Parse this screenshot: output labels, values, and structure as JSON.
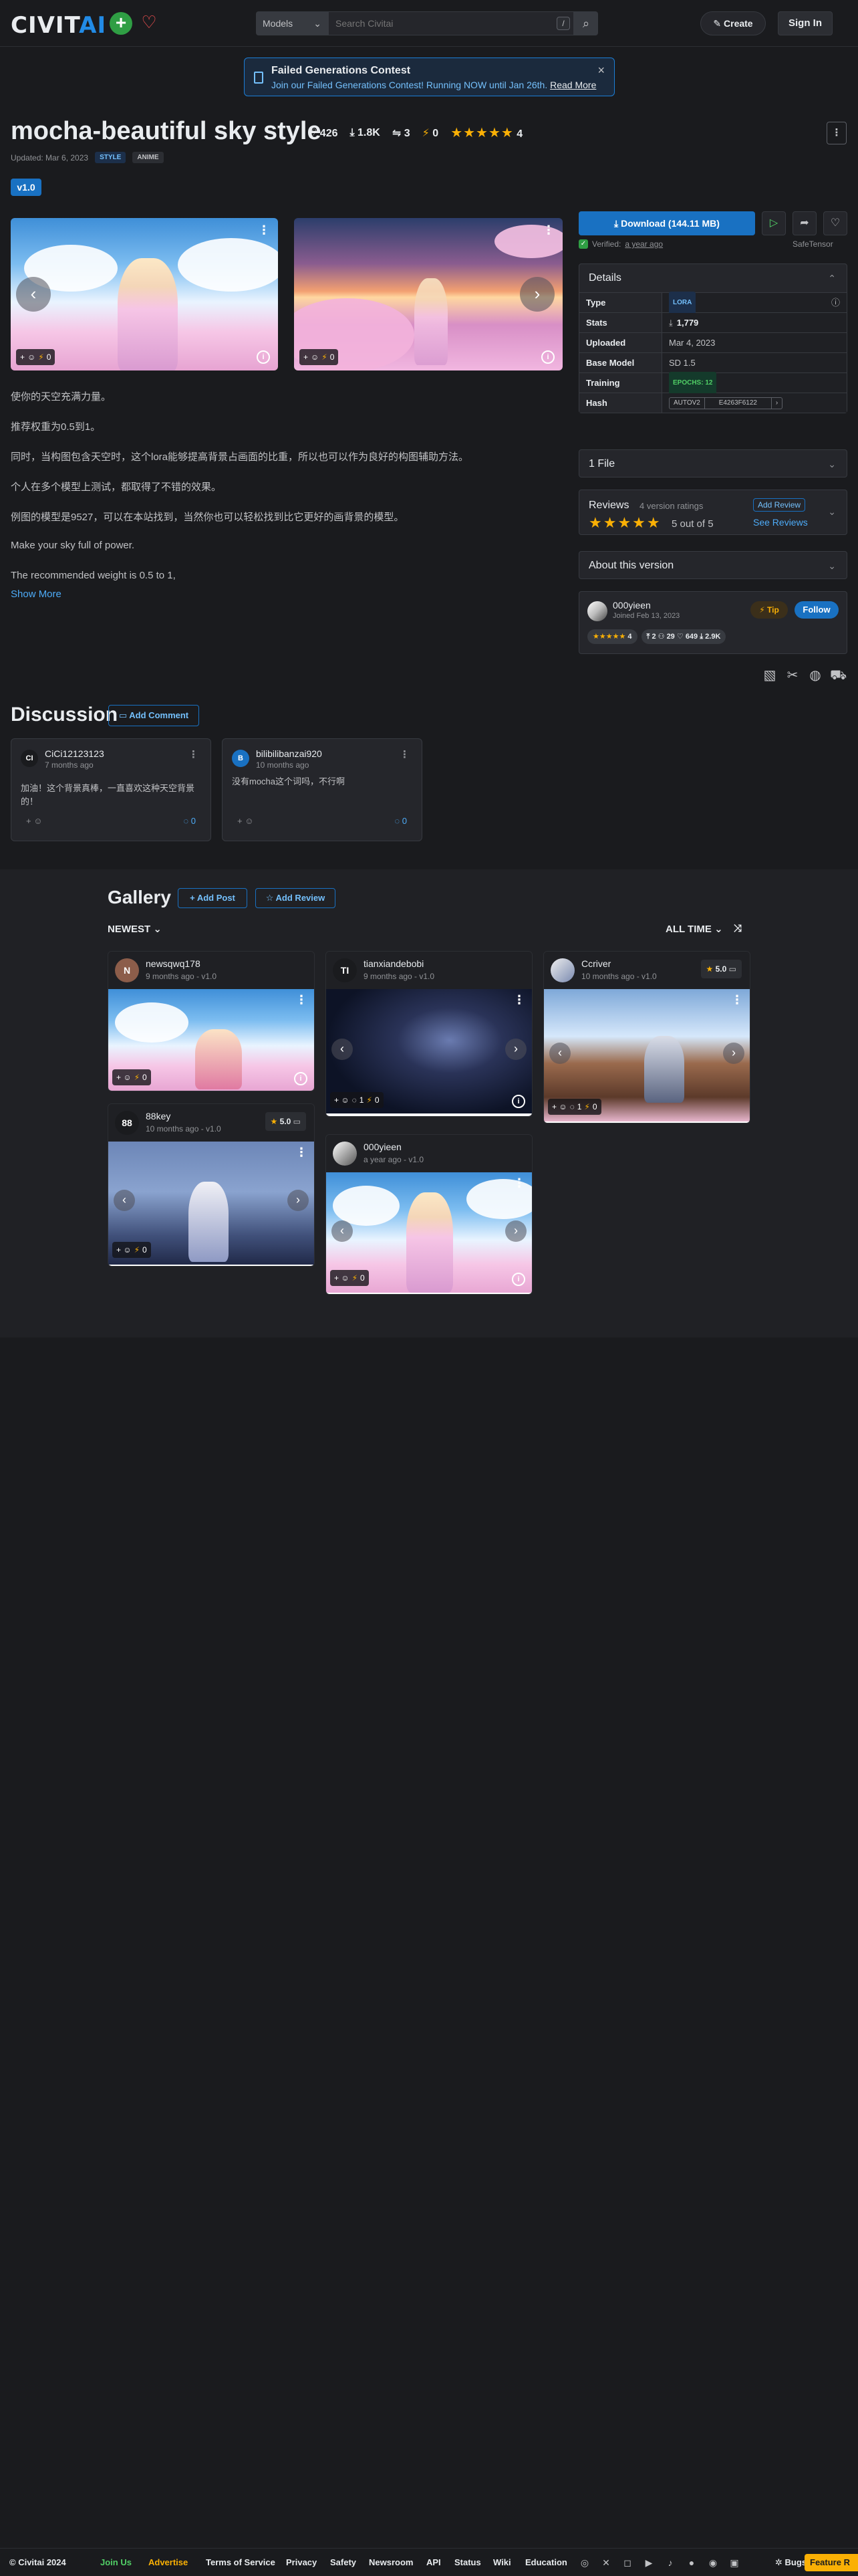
{
  "header": {
    "logo_text": "CIVIT",
    "logo_ai": "AI",
    "search_scope": "Models",
    "search_placeholder": "Search Civitai",
    "search_shortcut": "/",
    "create_label": "Create",
    "signin_label": "Sign In"
  },
  "banner": {
    "title": "Failed Generations Contest",
    "text": "Join our Failed Generations Contest! Running NOW until Jan 26th.",
    "link": "Read More"
  },
  "model": {
    "title": "mocha-beautiful sky style",
    "likes": "426",
    "downloads": "1.8K",
    "comments": "3",
    "buzz": "0",
    "rating_stars": "★★★★★",
    "rating_count": "4",
    "updated": "Updated: Mar 6, 2023",
    "tags": [
      "STYLE",
      "ANIME"
    ],
    "version": "v1.0"
  },
  "images": {
    "img1_reaction_count": "0",
    "img2_reaction_count": "0"
  },
  "description": [
    "使你的天空充满力量。",
    "推荐权重为0.5到1。",
    "同时，当构图包含天空时，这个lora能够提高背景占画面的比重，所以也可以作为良好的构图辅助方法。",
    "个人在多个模型上测试，都取得了不错的效果。",
    "例图的模型是9527，可以在本站找到，当然你也可以轻松找到比它更好的画背景的模型。",
    "Make your sky full of power.",
    "The recommended weight is 0.5 to 1,"
  ],
  "show_more": "Show More",
  "sidebar": {
    "download_label": "Download (144.11 MB)",
    "verified_label": "Verified:",
    "verified_when": "a year ago",
    "file_format": "SafeTensor",
    "details_title": "Details",
    "details": [
      {
        "key": "Type",
        "value": "LORA"
      },
      {
        "key": "Stats",
        "value": "1,779"
      },
      {
        "key": "Uploaded",
        "value": "Mar 4, 2023"
      },
      {
        "key": "Base Model",
        "value": "SD 1.5"
      },
      {
        "key": "Training",
        "value": "EPOCHS: 12"
      },
      {
        "key": "Hash",
        "value": "AUTOV2"
      }
    ],
    "hash_value": "E4263F6122",
    "files_title": "1 File",
    "reviews_title": "Reviews",
    "reviews_count": "4 version ratings",
    "reviews_stars": "★★★★★",
    "reviews_score": "5 out of 5",
    "add_review": "Add Review",
    "see_reviews": "See Reviews",
    "about_title": "About this version",
    "creator_name": "000yieen",
    "creator_joined": "Joined Feb 13, 2023",
    "tip_label": "Tip",
    "follow_label": "Follow",
    "creator_rating": "4",
    "creator_uploads": "2",
    "creator_followers": "29",
    "creator_likes": "649",
    "creator_downloads": "2.9K"
  },
  "discussion": {
    "title": "Discussion",
    "add_comment": "Add Comment",
    "comments": [
      {
        "name": "CiCi12123123",
        "time": "7 months ago",
        "text": "加油！这个背景真棒，一直喜欢这种天空背景的！",
        "count": "0",
        "avatar": "CI"
      },
      {
        "name": "bilibilibanzai920",
        "time": "10 months ago",
        "text": "没有mocha这个词吗，不行啊",
        "count": "0",
        "avatar": "B"
      }
    ]
  },
  "gallery": {
    "title": "Gallery",
    "add_post": "Add Post",
    "add_review": "Add Review",
    "sort_label": "NEWEST",
    "period_label": "ALL TIME",
    "cards": [
      {
        "name": "newsqwq178",
        "time": "9 months ago - v1.0",
        "avatar": "N",
        "reactions": "0"
      },
      {
        "name": "tianxiandebobi",
        "time": "9 months ago - v1.0",
        "avatar": "TI",
        "reactions": "0",
        "count": "1"
      },
      {
        "name": "Ccriver",
        "time": "10 months ago - v1.0",
        "avatar": "C",
        "rating": "5.0",
        "reactions": "0",
        "count": "1"
      },
      {
        "name": "88key",
        "time": "10 months ago - v1.0",
        "avatar": "88",
        "rating": "5.0",
        "reactions": "0"
      },
      {
        "name": "000yieen",
        "time": "a year ago - v1.0",
        "avatar": "0",
        "reactions": "0"
      }
    ]
  },
  "footer": {
    "copyright": "© Civitai 2024",
    "join_us": "Join Us",
    "advertise": "Advertise",
    "terms": "Terms of Service",
    "privacy": "Privacy",
    "safety": "Safety",
    "newsroom": "Newsroom",
    "api": "API",
    "status": "Status",
    "wiki": "Wiki",
    "education": "Education",
    "bugs": "Bugs",
    "feature": "Feature R"
  },
  "colors": {
    "accent": "#1971c2",
    "background": "#1a1b1e",
    "star": "#fab005",
    "success": "#2f9e44"
  }
}
